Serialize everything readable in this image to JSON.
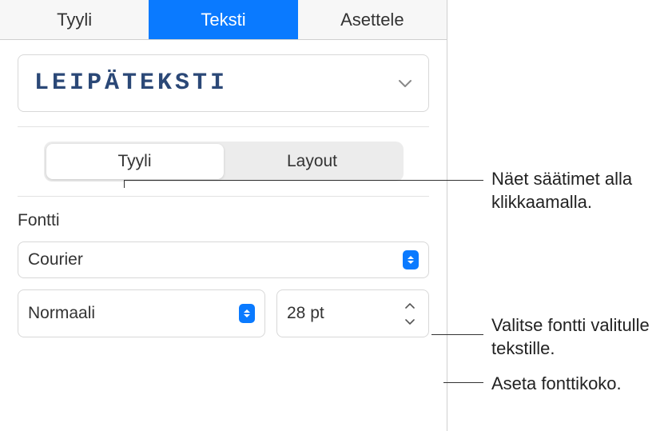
{
  "tabs": {
    "style": "Tyyli",
    "text": "Teksti",
    "arrange": "Asettele"
  },
  "paragraph_style": {
    "label": "Leipäteksti"
  },
  "segmented": {
    "style": "Tyyli",
    "layout": "Layout"
  },
  "font": {
    "section_label": "Fontti",
    "family": "Courier",
    "weight": "Normaali",
    "size": "28 pt"
  },
  "annotations": {
    "segment_hint": "Näet säätimet alla klikkaamalla.",
    "font_hint": "Valitse fontti valitulle tekstille.",
    "size_hint": "Aseta fonttikoko."
  }
}
